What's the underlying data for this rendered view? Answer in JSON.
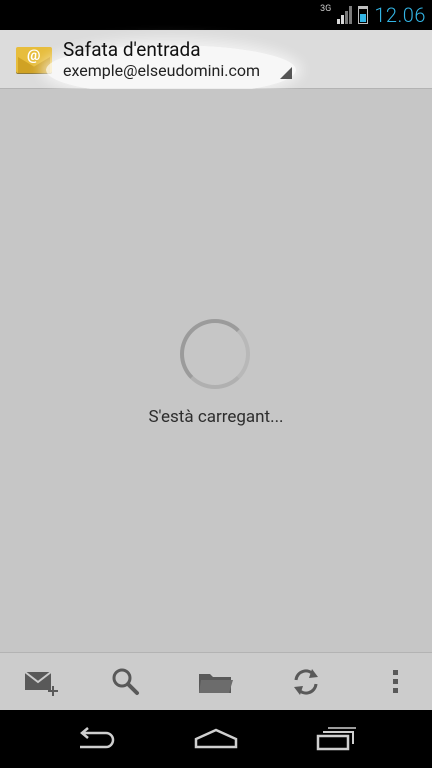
{
  "status_bar": {
    "network": "3G",
    "time": "12.06"
  },
  "action_bar": {
    "title": "Safata d'entrada",
    "account": "exemple@elseudomini.com"
  },
  "content": {
    "loading_text": "S'està carregant..."
  },
  "bottom_bar": {
    "icons": [
      "compose-icon",
      "search-icon",
      "folder-icon",
      "refresh-icon",
      "overflow-menu-icon"
    ]
  },
  "nav_bar": {
    "icons": [
      "back-icon",
      "home-icon",
      "recent-apps-icon"
    ]
  },
  "colors": {
    "accent": "#33b5e5",
    "background": "#c6c6c6",
    "action_bar": "#dcdcdc",
    "envelope": "#e7bd3c"
  }
}
